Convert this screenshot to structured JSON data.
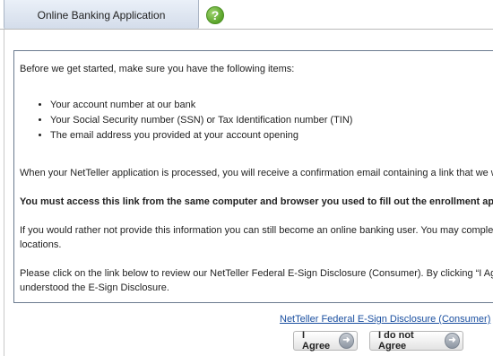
{
  "tabs": {
    "active_label": "Online Banking Application",
    "help_glyph": "?"
  },
  "content": {
    "intro": "Before we get started, make sure you have the following items:",
    "items": [
      "Your account number at our bank",
      "Your Social Security number (SSN) or Tax Identification number (TIN)",
      "The email address you provided at your account opening"
    ],
    "confirmation": "When your NetTeller application is processed, you will receive a confirmation email containing a link that we w",
    "must_access": "You must access this link from the same computer and browser you used to fill out the enrollment applic",
    "alternative_line1": "If you would rather not provide this information you can still become an online banking user. You may complet",
    "alternative_line2": "locations.",
    "esign_line1": "Please click on the link below to review our NetTeller Federal E-Sign Disclosure (Consumer). By clicking “I Ag",
    "esign_line2": "understood the E-Sign Disclosure."
  },
  "footer": {
    "disclosure_link": "NetTeller Federal E-Sign Disclosure (Consumer)",
    "agree_label": "I Agree",
    "disagree_label": "I do not Agree",
    "arrow_glyph": "➜"
  },
  "colors": {
    "link": "#1a4fa0",
    "help_icon": "#5aa42a",
    "border": "#6b7b8f"
  }
}
